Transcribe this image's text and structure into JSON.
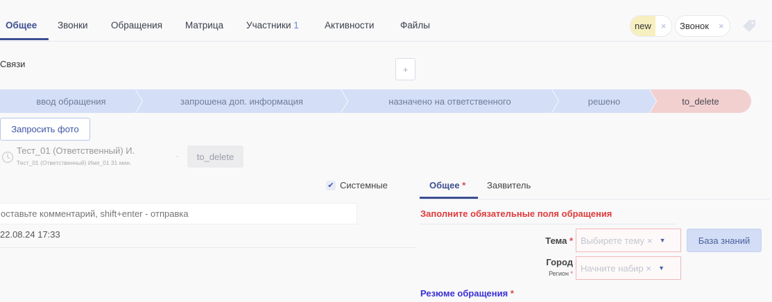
{
  "tabs": [
    {
      "label": "Общее"
    },
    {
      "label": "Звонки"
    },
    {
      "label": "Обращения"
    },
    {
      "label": "Матрица"
    },
    {
      "label": "Участники",
      "count": "1"
    },
    {
      "label": "Активности"
    },
    {
      "label": "Файлы"
    }
  ],
  "tags": [
    {
      "label": "new",
      "color": "#f7efbf"
    },
    {
      "label": "Звонок",
      "color": "#ffffff"
    }
  ],
  "tag_remove": "×",
  "links_title": "Связи",
  "add_label": "+",
  "pipeline": [
    "ввод обращения",
    "запрошена доп. информация",
    "назначено на ответственного",
    "решено",
    "to_delete"
  ],
  "request_photo": "Запросить фото",
  "activity": {
    "name": "Тест_01 (Ответственный) И.",
    "sub": "Тест_01 (Ответственный) Имя_01 31 мин.",
    "dash": "-",
    "status": "to_delete"
  },
  "system_checkbox": {
    "label": "Системные",
    "checked": true
  },
  "comment_placeholder": "оставьте комментарий, shift+enter - отправка",
  "date": "22.08.24 17:33",
  "form": {
    "tabs": [
      {
        "label": "Общее",
        "required": "*"
      },
      {
        "label": "Заявитель"
      }
    ],
    "warning": "Заполните обязательные поля обращения",
    "topic_label": "Тема",
    "topic_placeholder": "Выбирете тему",
    "kb_button": "База знаний",
    "city_label": "Город",
    "region_label": "Регион",
    "city_placeholder": "Начните набир",
    "required": "*",
    "clear": "×",
    "summary_label": "Резюме обращения"
  }
}
